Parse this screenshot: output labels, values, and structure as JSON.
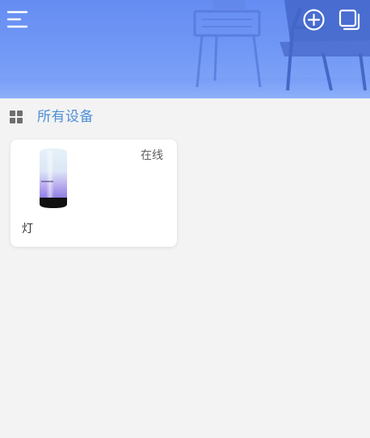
{
  "header": {
    "menu_icon": "menu-icon",
    "add_icon": "add-circle-icon",
    "copy_icon": "copy-icon"
  },
  "section": {
    "icon": "grid-icon",
    "title": "所有设备"
  },
  "devices": [
    {
      "name": "灯",
      "status": "在线",
      "image_icon": "lamp-icon"
    }
  ]
}
